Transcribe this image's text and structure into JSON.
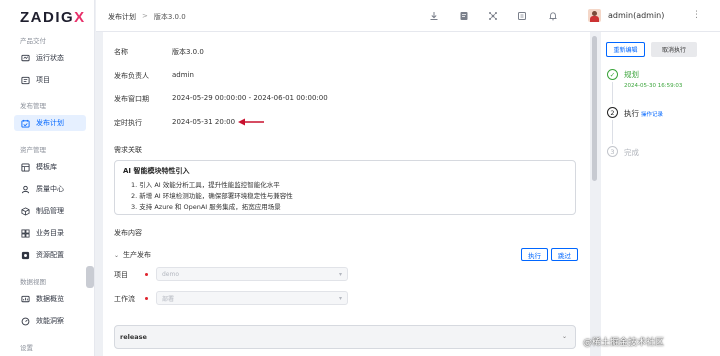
{
  "sidebar": {
    "logo_text": "ZADIG",
    "logo_x": "X",
    "groups": {
      "product": "产品交付",
      "release": "发布管理",
      "assets": "资产管理",
      "data": "数据视图",
      "settings": "设置"
    },
    "items": {
      "status": "运行状态",
      "project": "项目",
      "release_plan": "发布计划",
      "template": "模板库",
      "quality": "质量中心",
      "artifact": "制品管理",
      "service": "业务目录",
      "resource": "资源配置",
      "overview": "数据概览",
      "efficiency": "效能洞察"
    }
  },
  "header": {
    "crumb_root": "发布计划",
    "crumb_sep": ">",
    "crumb_current": "版本3.0.0",
    "username": "admin(admin)",
    "icons": [
      "download-icon",
      "document-icon",
      "network-icon",
      "calendar-icon",
      "bell-icon"
    ]
  },
  "main": {
    "fields": {
      "name_label": "名称",
      "name_value": "版本3.0.0",
      "owner_label": "发布负责人",
      "owner_value": "admin",
      "window_label": "发布窗口期",
      "window_value": "2024-05-29 00:00:00 - 2024-06-01 00:00:00",
      "schedule_label": "定时执行",
      "schedule_value": "2024-05-31 20:00"
    },
    "requirements": {
      "section_label": "需求关联",
      "title": "AI 智能模块特性引入",
      "items": [
        "1. 引入 AI 效能分析工具，提升性能监控智能化水平",
        "2. 新增 AI 环境检测功能，确保部署环境稳定性与兼容性",
        "3. 支持 Azure 和 OpenAI 服务集成，拓宽应用场景"
      ]
    },
    "content": {
      "section_label": "发布内容",
      "stage_name": "生产发布",
      "run_button": "执行",
      "skip_button": "跳过",
      "project_label": "项目",
      "project_value": "demo",
      "workflow_label": "工作流",
      "workflow_value": "部署",
      "release_value": "release"
    }
  },
  "side": {
    "edit_button": "重新编辑",
    "cancel_button": "取消执行",
    "steps": [
      {
        "name": "规划",
        "sub": "2024-05-30 16:59:03",
        "state": "done"
      },
      {
        "index": "2",
        "name": "执行",
        "link": "操作记录",
        "state": "current"
      },
      {
        "index": "3",
        "name": "完成",
        "state": "pending"
      }
    ]
  },
  "watermark": "@稀土掘金技术社区",
  "colors": {
    "accent": "#0066ff",
    "success": "#3aa43a",
    "required": "#e0242e",
    "arrow": "#c8102e",
    "brand_pink": "#e8306a"
  }
}
